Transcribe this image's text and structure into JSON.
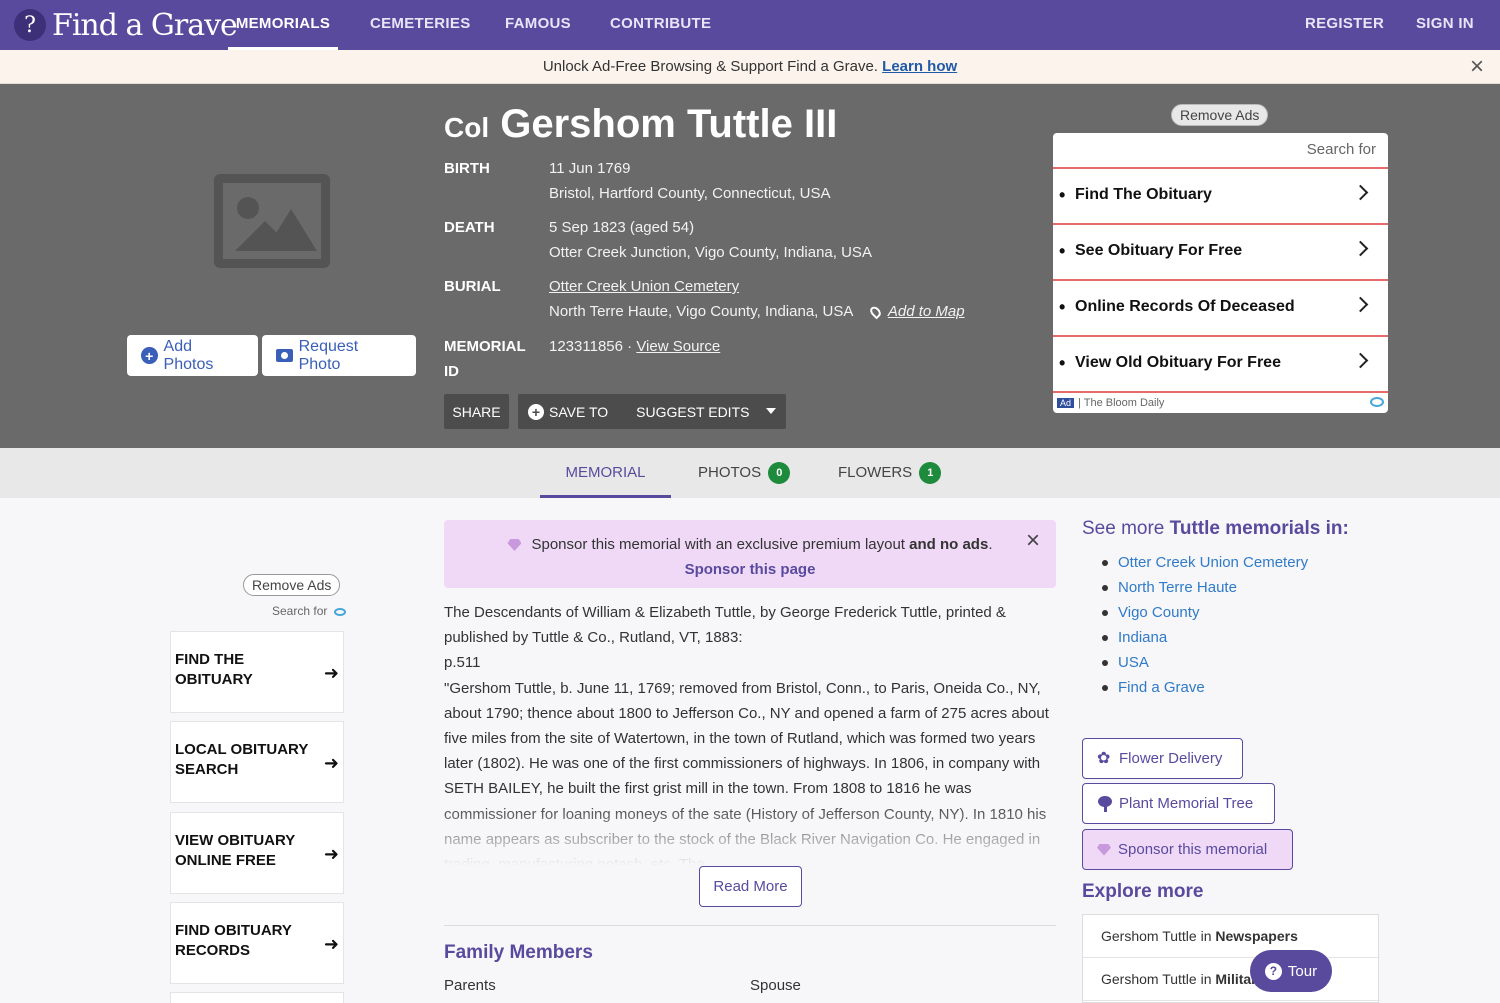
{
  "brand": {
    "logo_text": "Find a Grave",
    "logo_mark": "?"
  },
  "nav": {
    "memorials": "MEMORIALS",
    "cemeteries": "CEMETERIES",
    "famous": "FAMOUS",
    "contribute": "CONTRIBUTE",
    "register": "REGISTER",
    "sign_in": "SIGN IN"
  },
  "promo": {
    "text": "Unlock Ad-Free Browsing & Support Find a Grave.",
    "link": "Learn how",
    "close": "×"
  },
  "memorial": {
    "prefix": "Col",
    "name": "Gershom Tuttle III",
    "birth_label": "BIRTH",
    "birth_date": "11 Jun 1769",
    "birth_place": "Bristol, Hartford County, Connecticut, USA",
    "death_label": "DEATH",
    "death_date": "5 Sep 1823 (aged 54)",
    "death_place": "Otter Creek Junction, Vigo County, Indiana, USA",
    "burial_label": "BURIAL",
    "burial_cemetery": "Otter Creek Union Cemetery",
    "burial_place": "North Terre Haute, Vigo County, Indiana, USA",
    "add_to_map": "Add to Map",
    "memorial_id_label_1": "MEMORIAL",
    "memorial_id_label_2": "ID",
    "memorial_id": "123311856 ·",
    "view_source": "View Source"
  },
  "photo_buttons": {
    "add": "Add Photos",
    "request": "Request Photo"
  },
  "actions": {
    "share": "SHARE",
    "save_to": "SAVE TO",
    "suggest_edits": "SUGGEST EDITS"
  },
  "top_ad": {
    "remove_ads": "Remove Ads",
    "search_for": "Search for",
    "items": [
      "Find The Obituary",
      "See Obituary For Free",
      "Online Records Of Deceased",
      "View Old Obituary For Free"
    ],
    "badge": "Ad",
    "source": "| The Bloom Daily"
  },
  "tabs": {
    "memorial": "MEMORIAL",
    "photos": "PHOTOS",
    "photos_count": "0",
    "flowers": "FLOWERS",
    "flowers_count": "1"
  },
  "left_ad": {
    "remove_ads": "Remove Ads",
    "search_for": "Search for",
    "items": [
      "FIND THE OBITUARY",
      "LOCAL OBITUARY SEARCH",
      "VIEW OBITUARY ONLINE FREE",
      "FIND OBITUARY RECORDS"
    ],
    "arrow": "➜"
  },
  "sponsor": {
    "text": "Sponsor this memorial with an exclusive premium layout",
    "and": "and no ads",
    "period": ".",
    "link": "Sponsor this page",
    "close": "×"
  },
  "bio": {
    "text": "The Descendants of William & Elizabeth Tuttle, by George Frederick Tuttle, printed & published by Tuttle & Co., Rutland, VT, 1883:\np.511\n\"Gershom Tuttle, b. June 11, 1769; removed from Bristol, Conn., to Paris, Oneida Co., NY, about 1790; thence about 1800 to Jefferson Co., NY and opened a farm of 275 acres about five miles from the site of Watertown, in the town of Rutland, which was formed two years later (1802). He was one of the first commissioners of highways. In 1806, in company with SETH BAILEY, he built the first grist mill in the town. From 1808 to 1816 he was commissioner for loaning moneys of the sate (History of Jefferson County, NY). In 1810 his name appears as subscriber to the stock of the Black River Navigation Co. He engaged in trading, manufacturing potash, etc. The",
    "read_more": "Read More"
  },
  "family": {
    "heading": "Family Members",
    "parents": "Parents",
    "spouse": "Spouse"
  },
  "see_more": {
    "prefix": "See more",
    "surname": "Tuttle",
    "suffix": "memorials in:",
    "links": [
      "Otter Creek Union Cemetery",
      "North Terre Haute",
      "Vigo County",
      "Indiana",
      "USA",
      "Find a Grave"
    ]
  },
  "side_buttons": {
    "flower": "Flower Delivery",
    "tree": "Plant Memorial Tree",
    "sponsor": "Sponsor this memorial"
  },
  "explore": {
    "heading": "Explore more",
    "row1_prefix": "Gershom Tuttle in",
    "row1_bold": "Newspapers",
    "row2_prefix": "Gershom Tuttle in",
    "row2_bold": "Military"
  },
  "tour": {
    "label": "Tour",
    "icon": "?"
  },
  "colors": {
    "brand_purple": "#5a4a9e",
    "hero_gray": "#6a6a6a",
    "ad_red": "#e86b6b",
    "badge_green": "#1e8a3c",
    "link_blue": "#2f7bc7"
  }
}
